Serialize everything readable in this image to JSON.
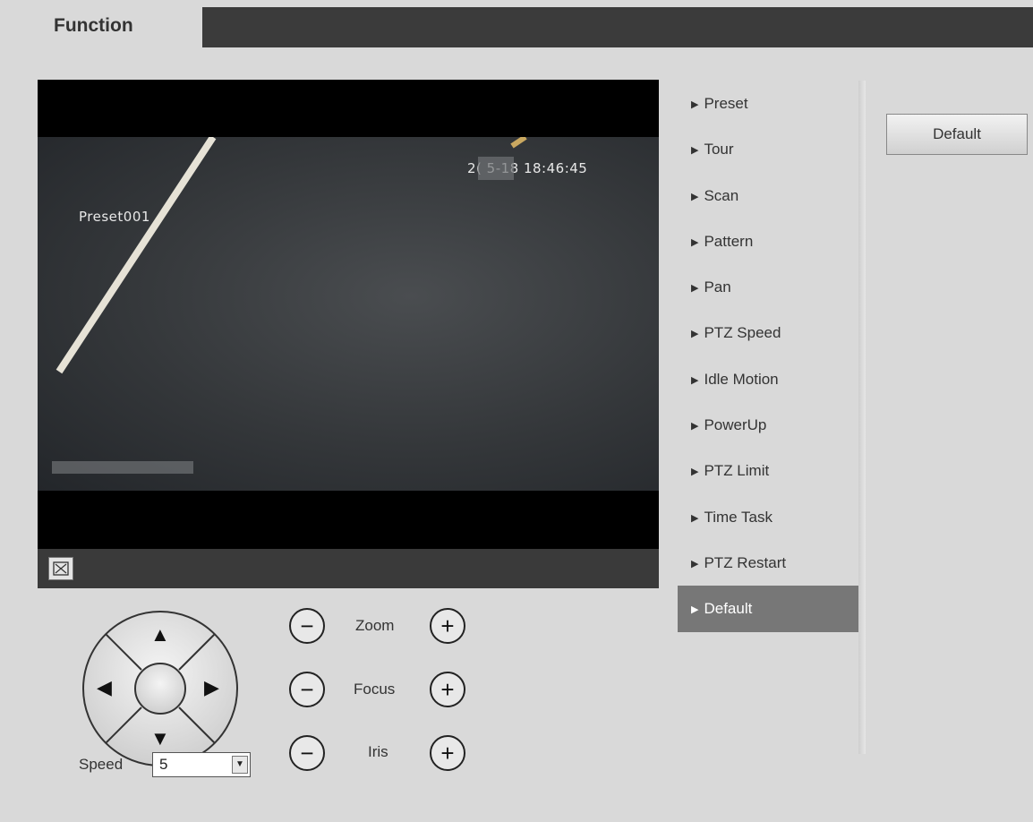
{
  "header": {
    "tab_label": "Function"
  },
  "video": {
    "timestamp": "2( 5-18 18:46:45",
    "preset_label": "Preset001"
  },
  "ptz": {
    "zoom_label": "Zoom",
    "focus_label": "Focus",
    "iris_label": "Iris",
    "minus_symbol": "−",
    "plus_symbol": "+",
    "speed_label": "Speed",
    "speed_value": "5"
  },
  "menu": {
    "items": [
      {
        "label": "Preset"
      },
      {
        "label": "Tour"
      },
      {
        "label": "Scan"
      },
      {
        "label": "Pattern"
      },
      {
        "label": "Pan"
      },
      {
        "label": "PTZ Speed"
      },
      {
        "label": "Idle Motion"
      },
      {
        "label": "PowerUp"
      },
      {
        "label": "PTZ Limit"
      },
      {
        "label": "Time Task"
      },
      {
        "label": "PTZ Restart"
      },
      {
        "label": "Default"
      }
    ],
    "active_index": 11
  },
  "actions": {
    "default_button": "Default"
  },
  "icons": {
    "fullscreen": "fullscreen-icon",
    "menu_arrow": "triangle-right-icon",
    "dropdown": "chevron-down-icon"
  },
  "colors": {
    "background": "#d9d9d9",
    "header_strip": "#3b3b3b",
    "active_menu": "#777777"
  }
}
